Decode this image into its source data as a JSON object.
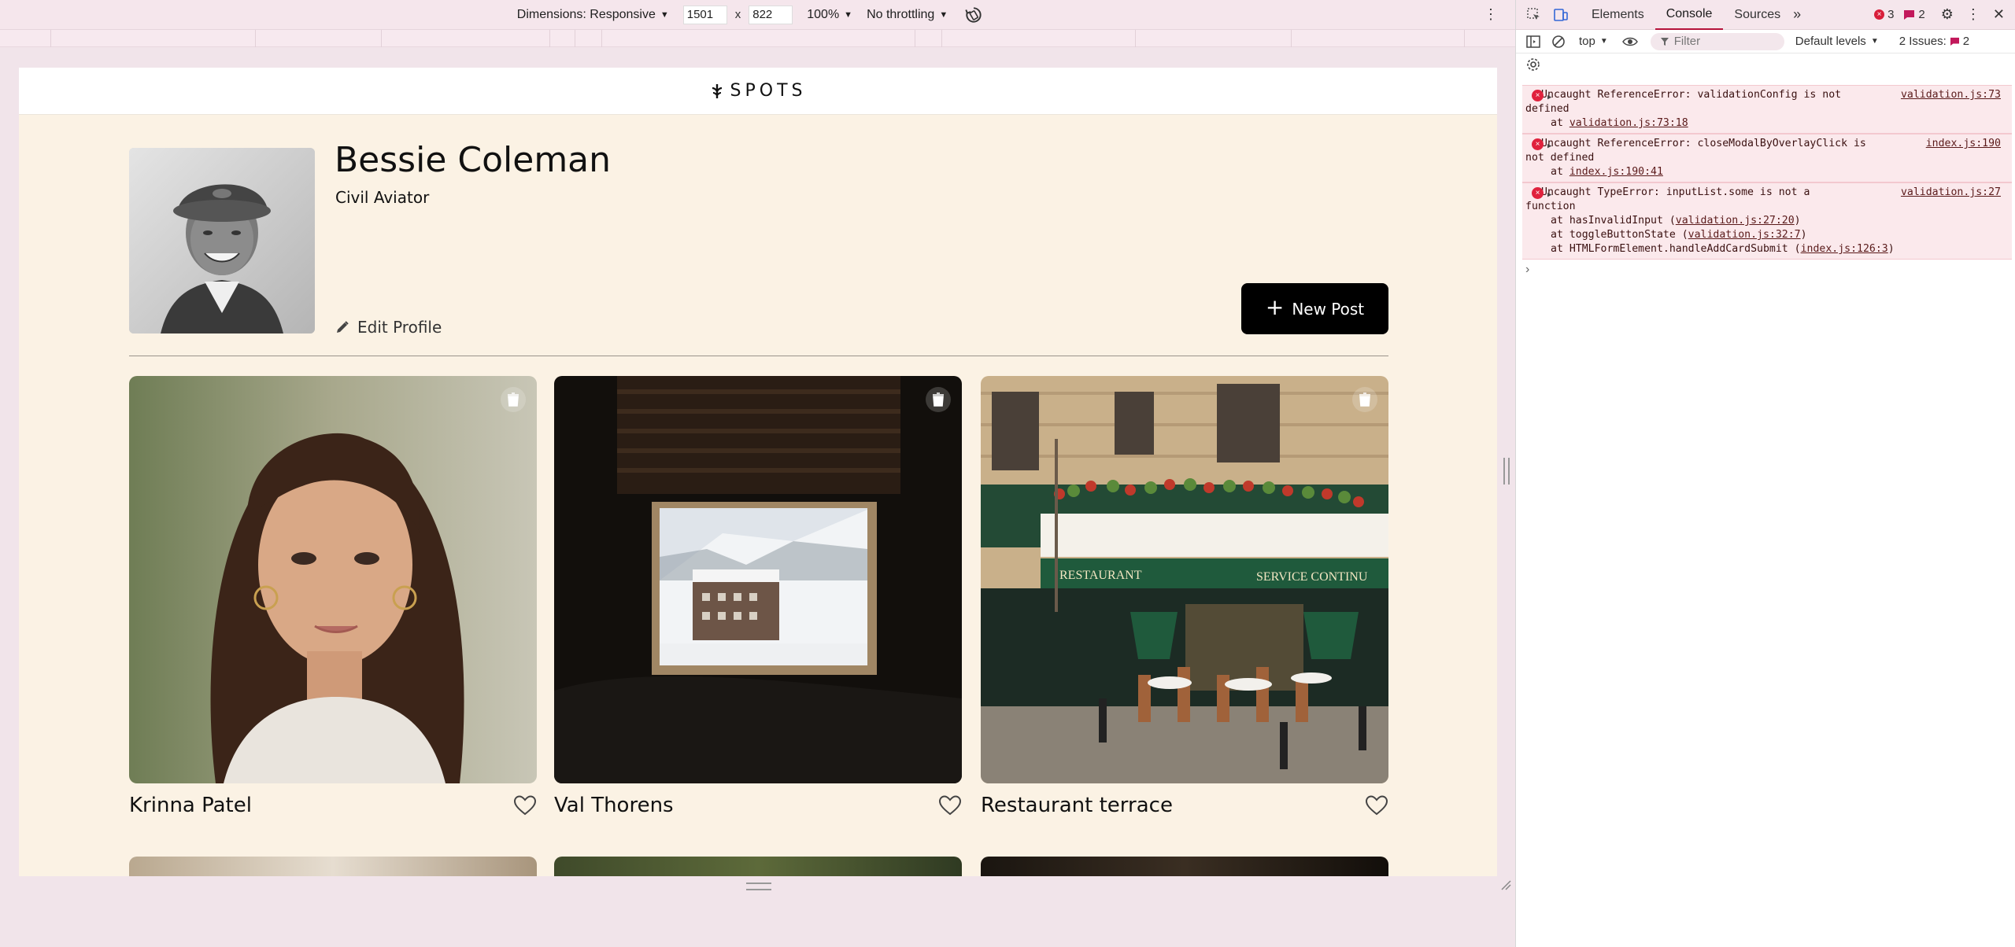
{
  "device_toolbar": {
    "dimensions_label": "Dimensions: Responsive",
    "width_value": "1501",
    "times": "x",
    "height_value": "822",
    "zoom": "100%",
    "throttling": "No throttling"
  },
  "site": {
    "logo_text": "SPOTS",
    "profile": {
      "name": "Bessie Coleman",
      "description": "Civil Aviator",
      "edit_label": "Edit Profile"
    },
    "new_post_label": "New Post",
    "cards": [
      {
        "title": "Krinna Patel"
      },
      {
        "title": "Val Thorens"
      },
      {
        "title": "Restaurant terrace"
      }
    ]
  },
  "devtools": {
    "tabs": [
      "Elements",
      "Console",
      "Sources"
    ],
    "active_tab": "Console",
    "error_count": "3",
    "message_count": "2",
    "context": "top",
    "filter_placeholder": "Filter",
    "levels": "Default levels",
    "issues_label": "2 Issues:",
    "issues_count": "2",
    "logs": [
      {
        "message": "Uncaught ReferenceError: validationConfig is not",
        "message_cont": "defined",
        "source": "validation.js:73",
        "stack": [
          {
            "prefix": "at ",
            "link": "validation.js:73:18",
            "suffix": ""
          }
        ]
      },
      {
        "message": "Uncaught ReferenceError: closeModalByOverlayClick is",
        "message_cont": "not defined",
        "source": "index.js:190",
        "stack": [
          {
            "prefix": "at ",
            "link": "index.js:190:41",
            "suffix": ""
          }
        ]
      },
      {
        "message": "Uncaught TypeError: inputList.some is not a",
        "message_cont": "function",
        "source": "validation.js:27",
        "stack": [
          {
            "prefix": "at hasInvalidInput (",
            "link": "validation.js:27:20",
            "suffix": ")"
          },
          {
            "prefix": "at toggleButtonState (",
            "link": "validation.js:32:7",
            "suffix": ")"
          },
          {
            "prefix": "at HTMLFormElement.handleAddCardSubmit (",
            "link": "index.js:126:3",
            "suffix": ")"
          }
        ]
      }
    ],
    "prompt": "›"
  },
  "colors": {
    "page_bg": "#fbf2e4",
    "error_bg": "#fbe9ec",
    "error_icon": "#e0223d",
    "active_tab_underline": "#b5123a",
    "button_bg": "#000000"
  }
}
